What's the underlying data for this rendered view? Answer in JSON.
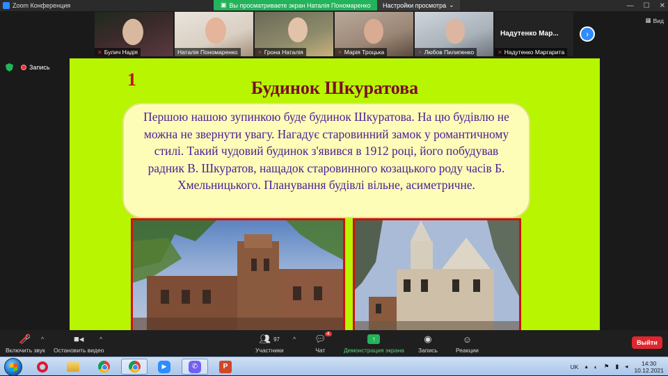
{
  "window": {
    "title": "Zoom Конференция",
    "share_banner": "Вы просматриваете экран Наталія Пономаренко",
    "view_options": "Настройки просмотра",
    "view_label": "Вид"
  },
  "gallery": {
    "tiles": [
      {
        "name": "Булич Надія",
        "muted": true
      },
      {
        "name": "Наталія Пономаренко",
        "muted": false
      },
      {
        "name": "Грона Наталія",
        "muted": true
      },
      {
        "name": "Марія Троцька",
        "muted": true
      },
      {
        "name": "Любов Пилипенко",
        "muted": true
      },
      {
        "name": "Надутенко Маргарита",
        "muted": true,
        "display_name": "Надутенко  Мар..."
      }
    ]
  },
  "recording": {
    "label": "Запись"
  },
  "slide": {
    "number": "1",
    "title": "Будинок Шкуратова",
    "body": "Першою нашою зупинкою буде будинок Шкуратова. На цю будівлю не можна не звернути увагу. Нагадує старовинний замок у романтичному стилі. Такий чудовий будинок з'явився в 1912 році, його побудував радник В. Шкуратов, нащадок старовинного козацького роду часів Б. Хмельницького. Планування будівлі вільне, асиметричне."
  },
  "toolbar": {
    "audio": "Включить звук",
    "video": "Остановить видео",
    "participants": "Участники",
    "participants_count": "97",
    "chat": "Чат",
    "chat_badge": "4",
    "share": "Демонстрация экрана",
    "record": "Запись",
    "reactions": "Реакции",
    "leave": "Выйти"
  },
  "taskbar": {
    "lang": "UK",
    "time": "14:30",
    "date": "10.12.2021"
  },
  "colors": {
    "slide_bg": "#b7f500",
    "title": "#7a0d2a",
    "body_text": "#4b2096",
    "share_green": "#23b35a",
    "leave_red": "#e0262e"
  }
}
